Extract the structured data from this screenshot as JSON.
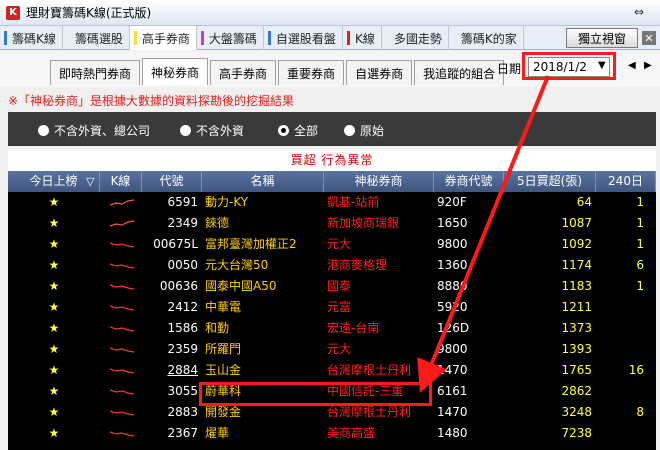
{
  "window": {
    "icon_letter": "K",
    "title": "理財寶籌碼K線(正式版)",
    "restore_glyph": "⇔"
  },
  "main_tabs": [
    {
      "label": "籌碼K線",
      "mark": "#3a78c8"
    },
    {
      "label": "籌碼選股",
      "mark": "#e8eef6"
    },
    {
      "label": "高手券商",
      "mark": "#f0e040",
      "active": true
    },
    {
      "label": "大盤籌碼",
      "mark": "#c040c0"
    },
    {
      "label": "自選股看盤",
      "mark": "#3a78c8"
    },
    {
      "label": "K線",
      "mark": "#e02020"
    },
    {
      "label": "多國走勢",
      "mark": "#e8eef6"
    },
    {
      "label": "籌碼K的家",
      "mark": "#e8eef6"
    }
  ],
  "toolbar": {
    "popup_label": "獨立視窗",
    "close_glyph": "✕"
  },
  "sub_tabs": [
    {
      "label": "即時熱門券商"
    },
    {
      "label": "神秘券商",
      "active": true
    },
    {
      "label": "高手券商"
    },
    {
      "label": "重要券商"
    },
    {
      "label": "自選券商"
    },
    {
      "label": "我追蹤的組合"
    }
  ],
  "date": {
    "label": "日期:",
    "value": "2018/1/2",
    "dropdown_glyph": "▼",
    "prev_glyph": "◀",
    "next_glyph": "▶"
  },
  "note": "※「神秘券商」是根據大數據的資料探勘後的挖掘結果",
  "filters": [
    {
      "label": "不含外資、總公司",
      "selected": false
    },
    {
      "label": "不含外資",
      "selected": false
    },
    {
      "label": "全部",
      "selected": true
    },
    {
      "label": "原始",
      "selected": false
    }
  ],
  "grid": {
    "title": "買超 行為異常",
    "columns": [
      "今日上榜",
      "K線",
      "代號",
      "名稱",
      "神秘券商",
      "券商代號",
      "5日買超(張)",
      "240日"
    ],
    "sort_glyph": "▽",
    "rows": [
      {
        "star": "★",
        "code": "6591",
        "name": "動力-KY",
        "broker": "凱基-站前",
        "bcode": "920F",
        "vol5": "64",
        "vol240": "1",
        "trend": "up"
      },
      {
        "star": "★",
        "code": "2349",
        "name": "錸德",
        "broker": "新加坡商瑞銀",
        "bcode": "1650",
        "vol5": "1087",
        "vol240": "1",
        "trend": "up"
      },
      {
        "star": "★",
        "code": "00675L",
        "name": "富邦臺灣加權正2",
        "broker": "元大",
        "bcode": "9800",
        "vol5": "1092",
        "vol240": "1",
        "trend": "down"
      },
      {
        "star": "★",
        "code": "0050",
        "name": "元大台灣50",
        "broker": "港商麥格理",
        "bcode": "1360",
        "vol5": "1174",
        "vol240": "6",
        "trend": "down"
      },
      {
        "star": "★",
        "code": "00636",
        "name": "國泰中國A50",
        "broker": "國泰",
        "bcode": "8880",
        "vol5": "1183",
        "vol240": "1",
        "trend": "down"
      },
      {
        "star": "★",
        "code": "2412",
        "name": "中華電",
        "broker": "元富",
        "bcode": "5920",
        "vol5": "1211",
        "vol240": "",
        "trend": "down"
      },
      {
        "star": "★",
        "code": "1586",
        "name": "和勤",
        "broker": "宏遠-台南",
        "bcode": "126D",
        "vol5": "1373",
        "vol240": "",
        "trend": "down"
      },
      {
        "star": "★",
        "code": "2359",
        "name": "所羅門",
        "broker": "元大",
        "bcode": "9800",
        "vol5": "1393",
        "vol240": "",
        "trend": "down"
      },
      {
        "star": "★",
        "code": "2884",
        "name": "玉山金",
        "broker": "台灣摩根士丹利",
        "bcode": "1470",
        "vol5": "1765",
        "vol240": "16",
        "trend": "down",
        "underline": true
      },
      {
        "star": "★",
        "code": "3055",
        "name": "蔚華科",
        "broker": "中國信託-三重",
        "bcode": "6161",
        "vol5": "2862",
        "vol240": "",
        "trend": "down"
      },
      {
        "star": "★",
        "code": "2883",
        "name": "開發金",
        "broker": "台灣摩根士丹利",
        "bcode": "1470",
        "vol5": "3248",
        "vol240": "8",
        "trend": "down"
      },
      {
        "star": "★",
        "code": "2367",
        "name": "燿華",
        "broker": "美商高盛",
        "bcode": "1480",
        "vol5": "7238",
        "vol240": "",
        "trend": "down"
      }
    ]
  },
  "colors": {
    "accent_red": "#ff1a1a",
    "grid_bg": "#000000",
    "header_blue": "#4a6290"
  }
}
